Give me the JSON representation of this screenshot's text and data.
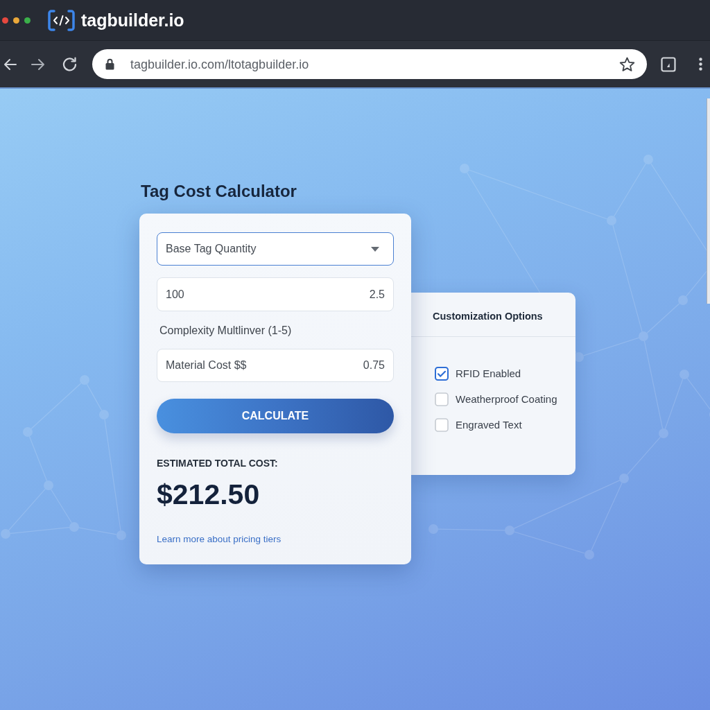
{
  "browser": {
    "app_title": "tagbuilder.io",
    "url": "tagbuilder.io.com/ltotagbuilder.io"
  },
  "calculator": {
    "title": "Tag Cost Calculator",
    "quantity_select": {
      "value": "Base Tag Quantity",
      "focused": true
    },
    "quantity_field": {
      "value": "100",
      "side_value": "2.5"
    },
    "complexity_label": "Complexity Multlinver (1-5)",
    "material_field": {
      "label": "Material Cost $$",
      "value": "0.75"
    },
    "calculate_button": "CALCULATE",
    "result_label": "ESTIMATED TOTAL COST:",
    "result_value": "$212.50",
    "pricing_link": "Learn more about pricing tiers"
  },
  "options": {
    "title": "Customization Options",
    "items": [
      {
        "label": "RFID Enabled",
        "checked": true
      },
      {
        "label": "Weatherproof Coating",
        "checked": false
      },
      {
        "label": "Engraved Text",
        "checked": false
      }
    ]
  }
}
